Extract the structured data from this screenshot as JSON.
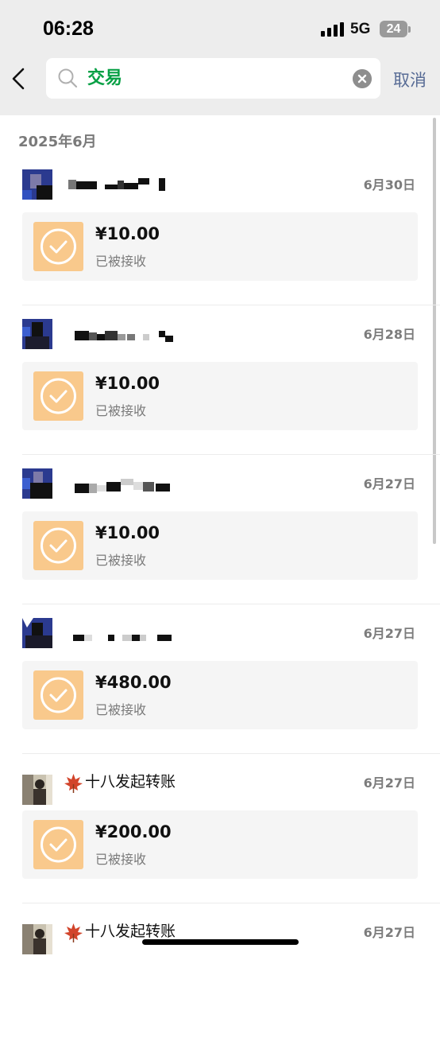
{
  "status_bar": {
    "time": "06:28",
    "network": "5G",
    "battery": "24"
  },
  "search": {
    "query": "交易",
    "cancel_label": "取消"
  },
  "section": {
    "label": "2025年6月"
  },
  "transactions": [
    {
      "sender": "",
      "date": "6月30日",
      "amount": "¥10.00",
      "status": "已被接收"
    },
    {
      "sender": "",
      "date": "6月28日",
      "amount": "¥10.00",
      "status": "已被接收"
    },
    {
      "sender": "",
      "date": "6月27日",
      "amount": "¥10.00",
      "status": "已被接收"
    },
    {
      "sender": "",
      "date": "6月27日",
      "amount": "¥480.00",
      "status": "已被接收"
    },
    {
      "sender": "十八发起转账",
      "date": "6月27日",
      "amount": "¥200.00",
      "status": "已被接收"
    },
    {
      "sender": "十八发起转账",
      "date": "6月27日",
      "amount": "",
      "status": ""
    }
  ],
  "icons": {
    "back": "chevron-left-icon",
    "search": "search-icon",
    "clear": "clear-icon",
    "check": "check-circle-icon",
    "leaf": "maple-leaf-icon"
  },
  "colors": {
    "header_bg": "#ededed",
    "accent_green": "#07a045",
    "link_blue": "#576b95",
    "check_tile": "#f9c98c"
  }
}
